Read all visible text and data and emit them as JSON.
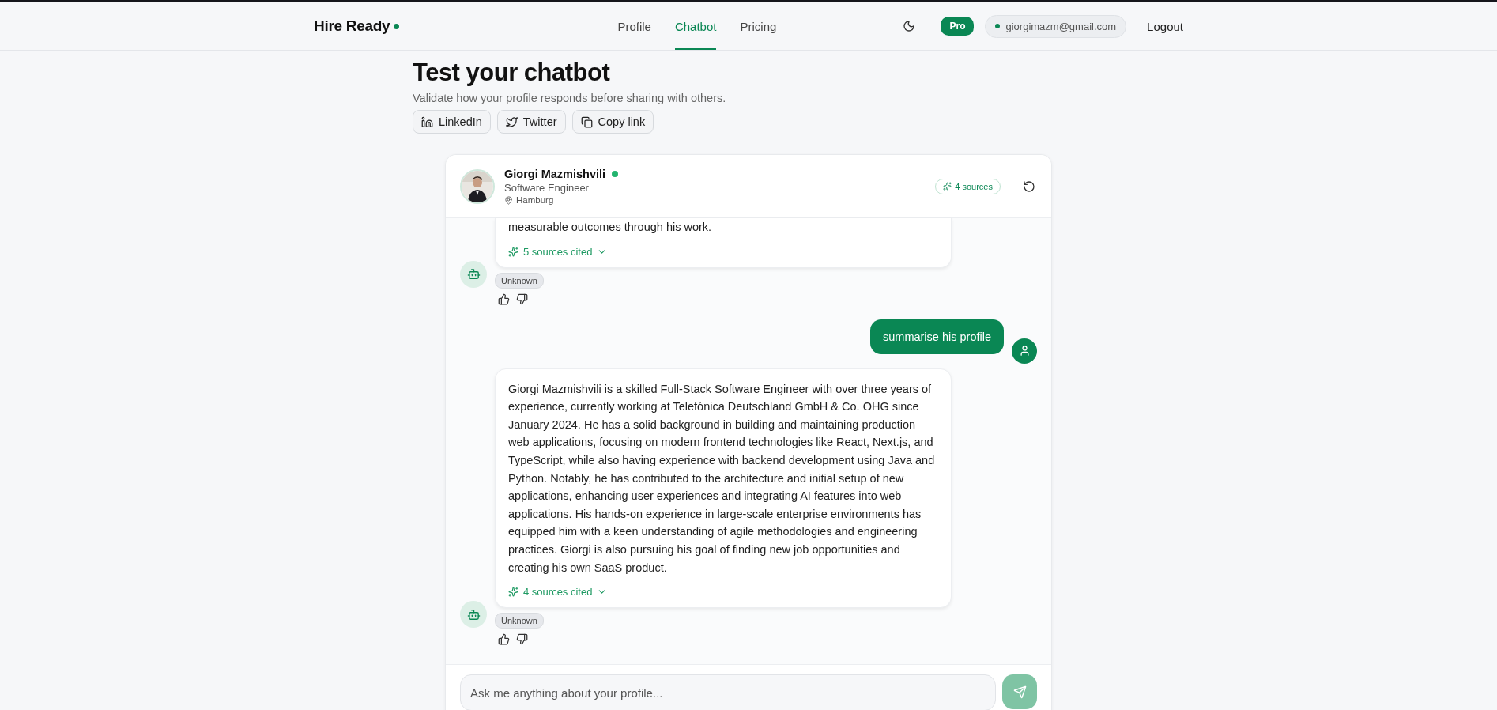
{
  "brand": {
    "name": "Hire Ready",
    "dot": true
  },
  "nav": [
    {
      "label": "Profile",
      "selected": false
    },
    {
      "label": "Chatbot",
      "selected": true
    },
    {
      "label": "Pricing",
      "selected": false
    }
  ],
  "account": {
    "plan": "Pro",
    "email": "giorgimazm@gmail.com",
    "logout": "Logout"
  },
  "page": {
    "title": "Test your chatbot",
    "subtitle": "Validate how your profile responds before sharing with others.",
    "share_buttons": [
      {
        "label": "LinkedIn",
        "kind": "linkedin"
      },
      {
        "label": "Twitter",
        "kind": "twitter"
      },
      {
        "label": "Copy link",
        "kind": "copy"
      }
    ]
  },
  "chat": {
    "profile": {
      "name": "Giorgi Mazmishvili",
      "online": true,
      "role": "Software Engineer",
      "location": "Hamburg"
    },
    "sources_badge": "4 sources",
    "messages": [
      {
        "kind": "bot",
        "clipped": true,
        "text": "measurable outcomes through his work.",
        "sources": "5 sources cited",
        "tag": "Unknown"
      },
      {
        "kind": "user",
        "text": "summarise his profile"
      },
      {
        "kind": "bot",
        "clipped": false,
        "text": "Giorgi Mazmishvili is a skilled Full-Stack Software Engineer with over three years of experience, currently working at Telefónica Deutschland GmbH & Co. OHG since January 2024. He has a solid background in building and maintaining production web applications, focusing on modern frontend technologies like React, Next.js, and TypeScript, while also having experience with backend development using Java and Python. Notably, he has contributed to the architecture and initial setup of new applications, enhancing user experiences and integrating AI features into web applications. His hands-on experience in large-scale enterprise environments has equipped him with a keen understanding of agile methodologies and engineering practices. Giorgi is also pursuing his goal of finding new job opportunities and creating his own SaaS product.",
        "sources": "4 sources cited",
        "tag": "Unknown"
      }
    ],
    "input": {
      "placeholder": "Ask me anything about your profile..."
    }
  }
}
